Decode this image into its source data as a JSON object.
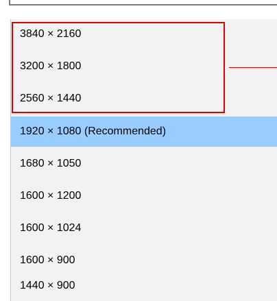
{
  "resolution_dropdown": {
    "options": [
      {
        "label": "3840 × 2160"
      },
      {
        "label": "3200 × 1800"
      },
      {
        "label": "2560 × 1440"
      },
      {
        "label": "1920 × 1080 (Recommended)",
        "selected": true
      },
      {
        "label": "1680 × 1050"
      },
      {
        "label": "1600 × 1200"
      },
      {
        "label": "1600 × 1024"
      },
      {
        "label": "1600 × 900"
      },
      {
        "label": "1440 × 900"
      }
    ],
    "selected_background": "#99ccff",
    "list_background": "#f2f2f2"
  },
  "annotation": {
    "color": "#e00000"
  }
}
